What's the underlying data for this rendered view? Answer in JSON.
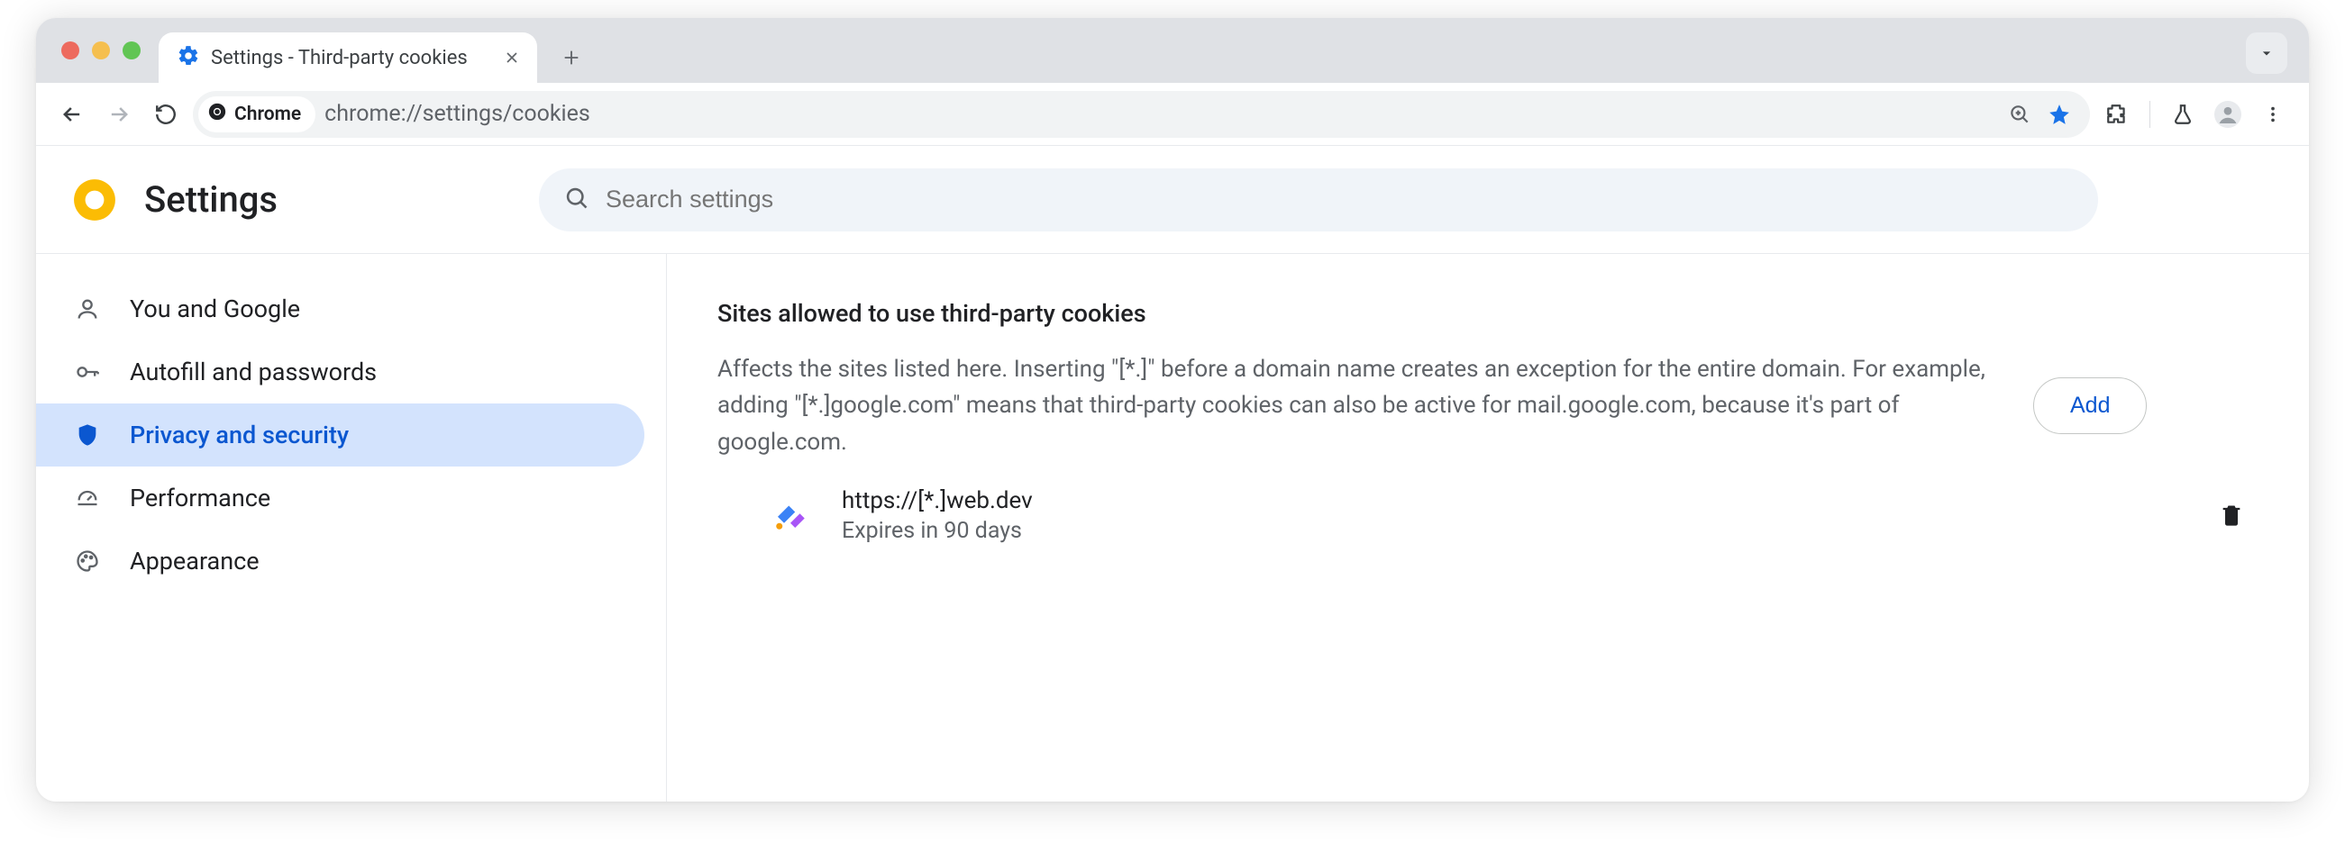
{
  "tab": {
    "title": "Settings - Third-party cookies"
  },
  "address": {
    "chip_label": "Chrome",
    "url": "chrome://settings/cookies"
  },
  "header": {
    "title": "Settings",
    "search_placeholder": "Search settings"
  },
  "sidebar": {
    "items": [
      {
        "label": "You and Google"
      },
      {
        "label": "Autofill and passwords"
      },
      {
        "label": "Privacy and security"
      },
      {
        "label": "Performance"
      },
      {
        "label": "Appearance"
      }
    ]
  },
  "section": {
    "title": "Sites allowed to use third-party cookies",
    "description": "Affects the sites listed here. Inserting \"[*.]\" before a domain name creates an exception for the entire domain. For example, adding \"[*.]google.com\" means that third-party cookies can also be active for mail.google.com, because it's part of google.com.",
    "add_label": "Add"
  },
  "sites": [
    {
      "url": "https://[*.]web.dev",
      "expires": "Expires in 90 days"
    }
  ]
}
